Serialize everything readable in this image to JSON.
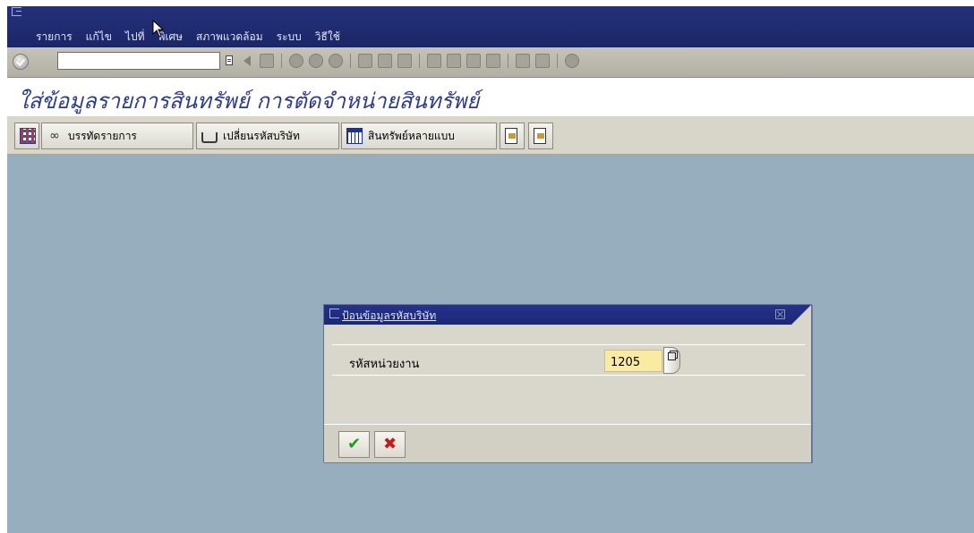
{
  "menu": {
    "items": [
      "รายการ",
      "แก้ไข",
      "ไปที่",
      "พิเศษ",
      "สภาพแวดล้อม",
      "ระบบ",
      "วิธีใช้"
    ]
  },
  "toolbar": {
    "command_field_value": ""
  },
  "screen": {
    "title": "ใส่ข้อมูลรายการสินทรัพย์ การตัดจำหน่ายสินทรัพย์"
  },
  "app_toolbar": {
    "line_items_label": "บรรทัดรายการ",
    "change_company_label": "เปลี่ยนรหัสบริษัท",
    "multiple_assets_label": "สินทรัพย์หลายแบบ"
  },
  "dialog": {
    "title": "ป้อนข้อมูลรหัสบริษัท",
    "field_label": "รหัสหน่วยงาน",
    "field_value": "1205",
    "ok_glyph": "✔",
    "cancel_glyph": "✖"
  },
  "colors": {
    "title_bar": "#1f2a72",
    "work_area": "#97aebe",
    "input_highlight": "#fbeaa1",
    "screen_title_text": "#2d3d8c"
  },
  "icons": [
    "enter-icon",
    "back-icon",
    "save-icon",
    "exit-icon",
    "cancel-icon",
    "print-icon",
    "find-icon",
    "help-icon",
    "value-help-icon",
    "confirm-icon",
    "cancel-x-icon"
  ]
}
